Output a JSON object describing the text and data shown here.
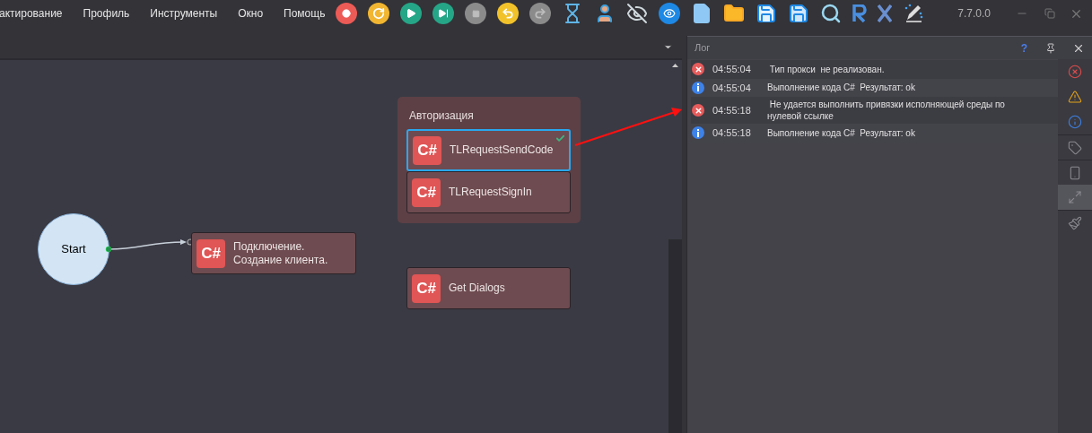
{
  "menu": [
    "актирование",
    "Профиль",
    "Инструменты",
    "Окно",
    "Помощь"
  ],
  "version": "7.7.0.0",
  "canvas": {
    "start": {
      "label": "Start"
    },
    "nodes": [
      {
        "badge": "C#",
        "title": "Подключение.\nСоздание клиента."
      },
      {
        "badge": "C#",
        "title": "Get Dialogs"
      }
    ],
    "group": {
      "title": "Авторизация",
      "items": [
        {
          "badge": "C#",
          "title": "TLRequestSendCode",
          "selected": true,
          "completed": true
        },
        {
          "badge": "C#",
          "title": "TLRequestSignIn",
          "selected": false,
          "completed": false
        }
      ]
    }
  },
  "log": {
    "title": "Лог",
    "help": "?",
    "entries": [
      {
        "kind": "error",
        "time": "04:55:04",
        "message": " Тип прокси  не реализован."
      },
      {
        "kind": "info",
        "time": "04:55:04",
        "message": "Выполнение кода C#  Результат: ok"
      },
      {
        "kind": "error",
        "time": "04:55:18",
        "message": " Не удается выполнить привязки исполняющей среды по нулевой ссылке"
      },
      {
        "kind": "info",
        "time": "04:55:18",
        "message": "Выполнение кода C#  Результат: ok"
      }
    ],
    "filters": [
      {
        "kind": "error",
        "selected": false
      },
      {
        "kind": "warning",
        "selected": false
      },
      {
        "kind": "info",
        "selected": false
      },
      {
        "kind": "tag",
        "selected": false
      },
      {
        "kind": "phone",
        "selected": false
      },
      {
        "kind": "expand",
        "selected": true
      },
      {
        "kind": "brush",
        "selected": false
      }
    ]
  }
}
